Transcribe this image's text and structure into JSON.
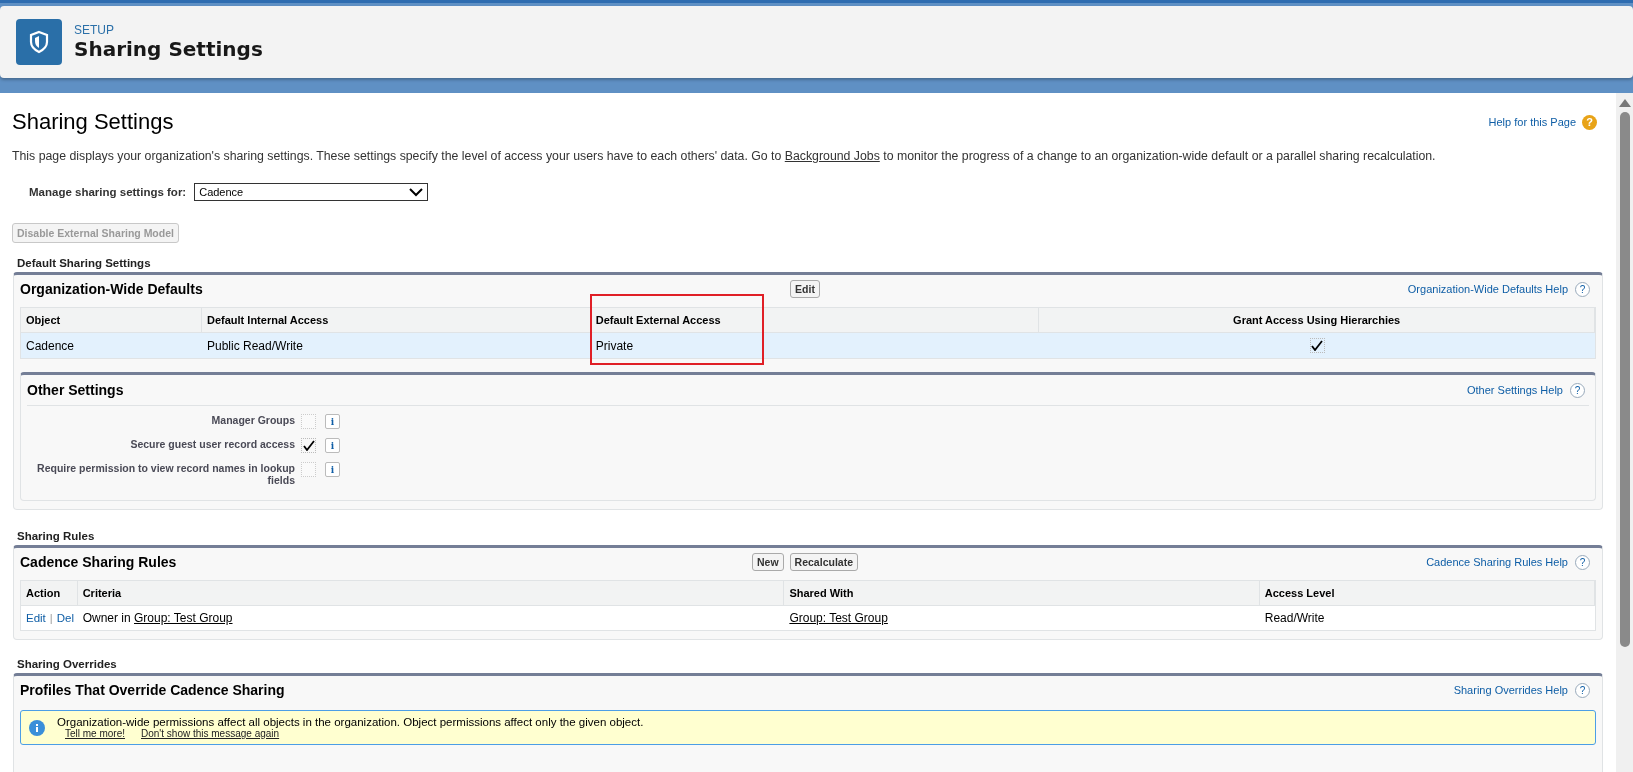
{
  "header": {
    "eyebrow": "SETUP",
    "title": "Sharing Settings"
  },
  "page": {
    "title": "Sharing Settings",
    "help_link": "Help for this Page",
    "help_icon": "?",
    "intro_before": "This page displays your organization's sharing settings. These settings specify the level of access your users have to each others' data. Go to ",
    "intro_link": "Background Jobs",
    "intro_after": " to monitor the progress of a change to an organization-wide default or a parallel sharing recalculation.",
    "manage_label": "Manage sharing settings for:",
    "manage_value": "Cadence",
    "disabled_button": {
      "label": "Disable External Sharing Model",
      "disabled": true
    }
  },
  "default_sharing": {
    "section_label": "Default Sharing Settings",
    "title": "Organization-Wide Defaults",
    "buttons": [
      "Edit"
    ],
    "help": "Organization-Wide Defaults Help",
    "help_icon": "?",
    "columns": [
      {
        "label": "Object",
        "highlighted": false
      },
      {
        "label": "Default Internal Access",
        "highlighted": false
      },
      {
        "label": "Default External Access",
        "highlighted": true
      },
      {
        "label": "Grant Access Using Hierarchies",
        "highlighted": false
      }
    ],
    "rows": [
      {
        "object": "Cadence",
        "internal": "Public Read/Write",
        "external": "Private",
        "grant_checked": true
      }
    ],
    "other_settings": {
      "title": "Other Settings",
      "help": "Other Settings Help",
      "help_icon": "?",
      "items": [
        {
          "label": "Manager Groups",
          "checked": false,
          "info_icon": "i"
        },
        {
          "label": "Secure guest user record access",
          "checked": true,
          "info_icon": "i"
        },
        {
          "label": "Require permission to view record names in lookup fields",
          "checked": false,
          "info_icon": "i"
        }
      ]
    }
  },
  "sharing_rules": {
    "section_label": "Sharing Rules",
    "title": "Cadence Sharing Rules",
    "buttons": [
      "New",
      "Recalculate"
    ],
    "help": "Cadence Sharing Rules Help",
    "help_icon": "?",
    "columns": [
      "Action",
      "Criteria",
      "Shared With",
      "Access Level"
    ],
    "rows": [
      {
        "actions": [
          "Edit",
          "Del"
        ],
        "action_separator": "|",
        "criteria_prefix": "Owner in ",
        "criteria_link": "Group: Test Group",
        "shared_with": "Group: Test Group",
        "access_level": "Read/Write"
      }
    ]
  },
  "sharing_overrides": {
    "section_label": "Sharing Overrides",
    "title": "Profiles That Override Cadence Sharing",
    "help": "Sharing Overrides Help",
    "help_icon": "?",
    "message": "Organization-wide permissions affect all objects in the organization. Object permissions affect only the given object.",
    "message_links": [
      "Tell me more!",
      "Don't show this message again"
    ]
  }
}
